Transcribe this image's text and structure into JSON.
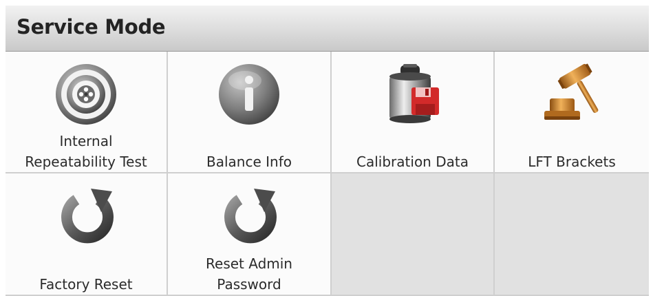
{
  "header": {
    "title": "Service Mode"
  },
  "tiles": [
    {
      "lines": [
        "Internal",
        "Repeatability Test"
      ],
      "icon": "target-icon"
    },
    {
      "lines": [
        "Balance Info"
      ],
      "icon": "info-icon"
    },
    {
      "lines": [
        "Calibration Data"
      ],
      "icon": "weight-save-icon"
    },
    {
      "lines": [
        "LFT Brackets"
      ],
      "icon": "gavel-icon"
    },
    {
      "lines": [
        "Factory Reset"
      ],
      "icon": "reset-icon"
    },
    {
      "lines": [
        "Reset Admin",
        "Password"
      ],
      "icon": "reset-icon"
    }
  ]
}
